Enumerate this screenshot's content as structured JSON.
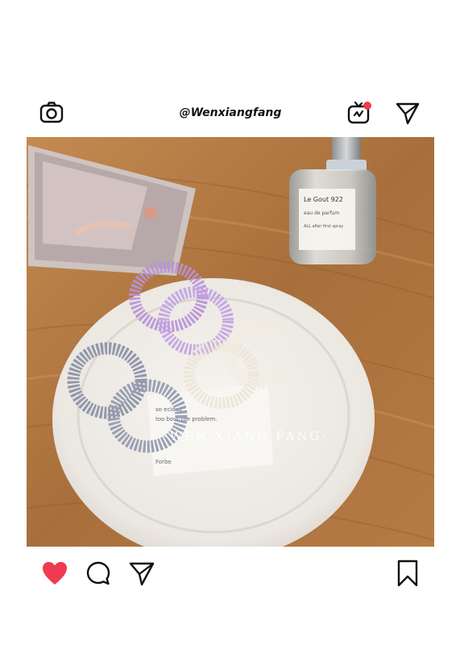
{
  "post": {
    "username": "@Wenxiangfang",
    "watermark": "·WEN XIANG FANG·",
    "icons": {
      "camera": "camera-icon",
      "igtv": "igtv-icon",
      "direct": "paper-plane-icon",
      "like": "heart-icon",
      "comment": "comment-icon",
      "share": "paper-plane-icon",
      "save": "bookmark-icon"
    },
    "colors": {
      "like": "#ef3b50",
      "notification_dot": "#ef3b50",
      "table": "#b27a44",
      "plate": "#f2efea"
    },
    "bottle_label": {
      "line1": "Le Gout 922",
      "line2": "eau de parfum",
      "line3": "ALL after first spray"
    },
    "card_text": {
      "line1": "so       ecious",
      "line2": "too       bout the problem.",
      "line3": "     Forbe"
    }
  }
}
